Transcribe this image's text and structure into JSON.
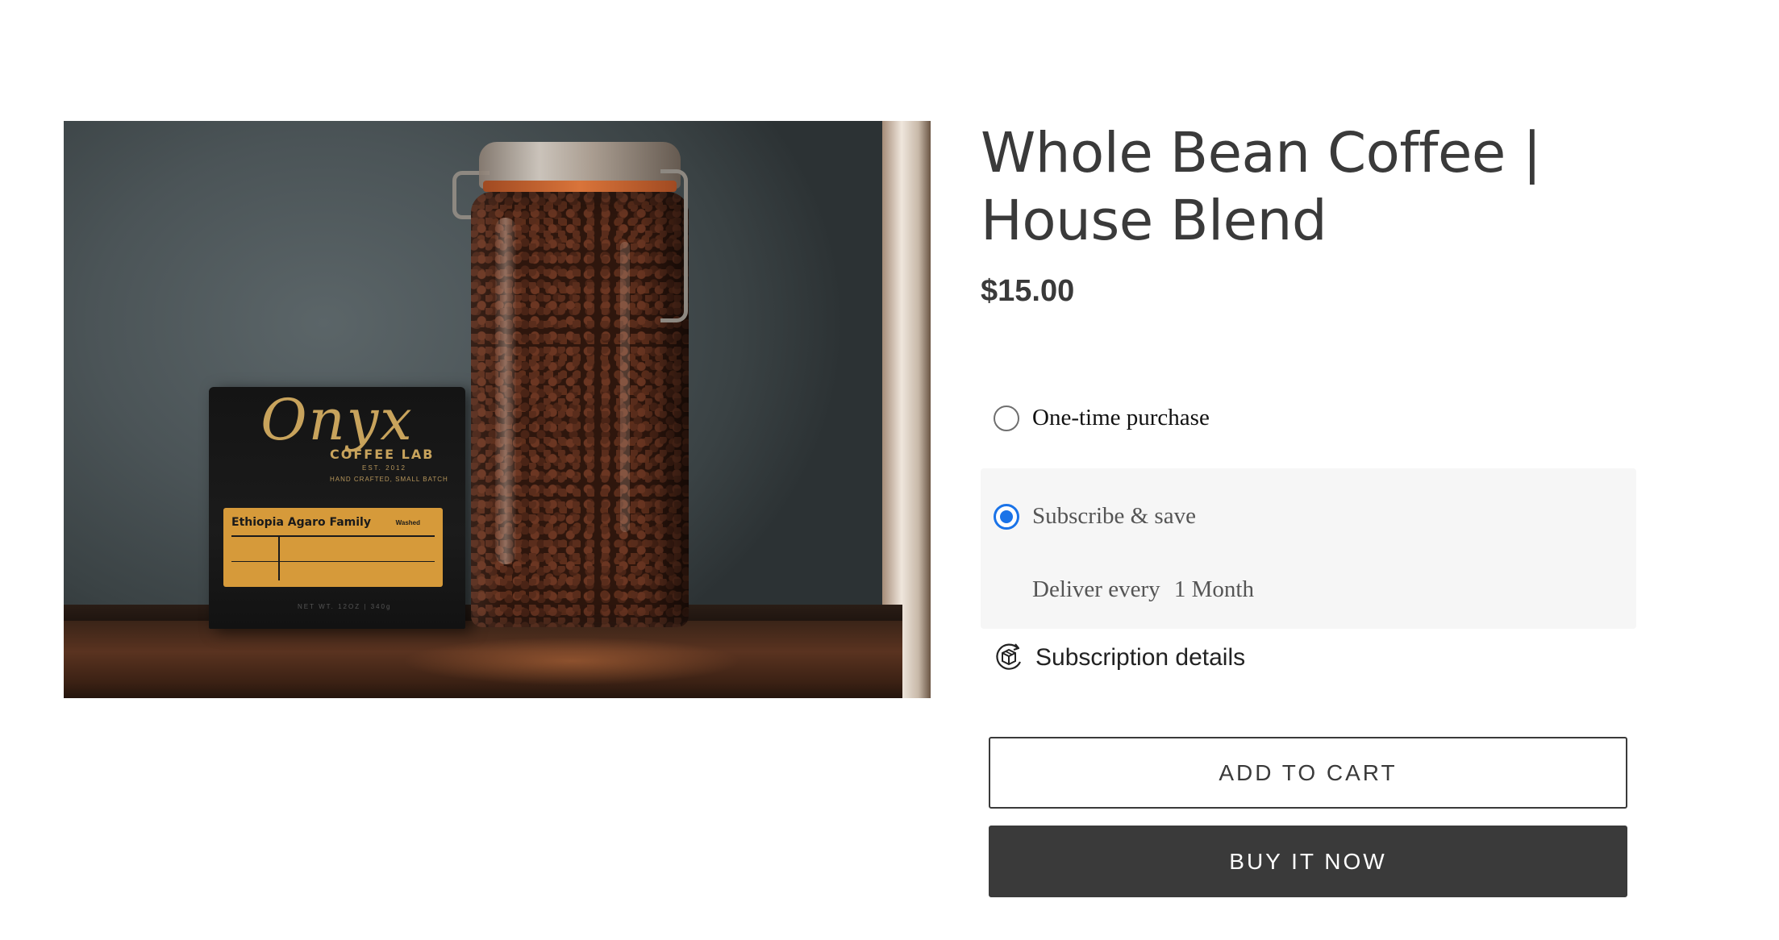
{
  "product": {
    "image_alt": "Onyx Coffee Lab bag and jar of whole bean coffee",
    "bag": {
      "logo": "Onyx",
      "brand_line": "COFFEE LAB",
      "est": "EST. 2012",
      "tagline": "HAND CRAFTED, SMALL BATCH",
      "label_title": "Ethiopia Agaro Family",
      "label_flag": "Washed",
      "net": "NET WT. 12OZ | 340g"
    },
    "title": "Whole Bean Coffee | House Blend",
    "price": "$15.00"
  },
  "purchase_options": {
    "one_time_label": "One-time purchase",
    "one_time_selected": false,
    "subscribe_label": "Subscribe & save",
    "subscribe_selected": true,
    "deliver_label": "Deliver every",
    "deliver_frequency": "1 Month",
    "details_label": "Subscription details",
    "details_icon": "subscription-box-icon",
    "accent_color": "#1a73e8",
    "subscribe_bg": "#f6f6f6"
  },
  "actions": {
    "add_to_cart_label": "ADD TO CART",
    "buy_now_label": "BUY IT NOW",
    "buy_now_bg": "#3a3a3a"
  }
}
